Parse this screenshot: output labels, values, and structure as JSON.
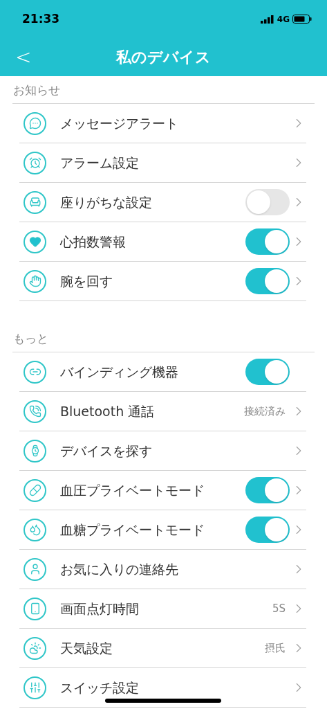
{
  "status_bar": {
    "time": "21:33",
    "network": "4G"
  },
  "nav": {
    "back": "<",
    "title": "私のデバイス"
  },
  "sections": [
    {
      "title": "お知らせ",
      "rows": [
        {
          "label": "メッセージアラート",
          "kind": "link"
        },
        {
          "label": "アラーム設定",
          "kind": "link"
        },
        {
          "label": "座りがちな設定",
          "kind": "switch_link",
          "on": false
        },
        {
          "label": "心拍数警報",
          "kind": "switch_link",
          "on": true
        },
        {
          "label": "腕を回す",
          "kind": "switch_link",
          "on": true
        }
      ]
    },
    {
      "title": "もっと",
      "rows": [
        {
          "label": "バインディング機器",
          "kind": "switch",
          "on": true
        },
        {
          "label": "Bluetooth 通話",
          "kind": "value_link",
          "value": "接続済み"
        },
        {
          "label": "デバイスを探す",
          "kind": "link"
        },
        {
          "label": "血圧プライベートモード",
          "kind": "switch_link",
          "on": true
        },
        {
          "label": "血糖プライベートモード",
          "kind": "switch_link",
          "on": true
        },
        {
          "label": "お気に入りの連絡先",
          "kind": "link"
        },
        {
          "label": "画面点灯時間",
          "kind": "value_link",
          "value": "5S"
        },
        {
          "label": "天気設定",
          "kind": "value_link",
          "value": "摂氏"
        },
        {
          "label": "スイッチ設定",
          "kind": "link"
        }
      ]
    }
  ]
}
